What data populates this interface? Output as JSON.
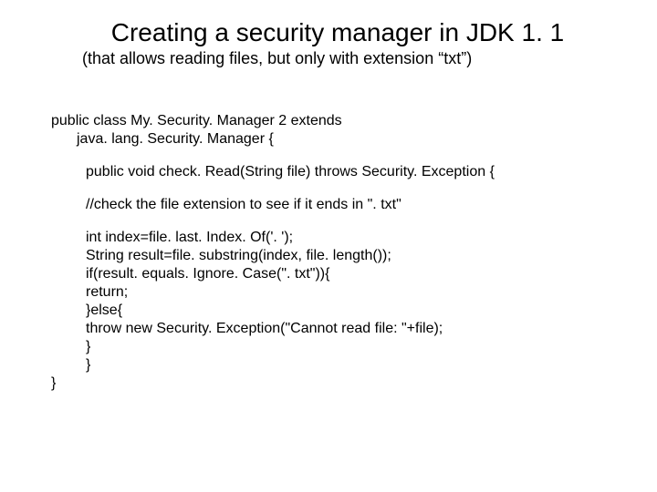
{
  "title": "Creating a security manager in JDK 1. 1",
  "subtitle": "(that allows reading files, but only with extension “txt”)",
  "code": {
    "l1": "public class My. Security. Manager 2 extends",
    "l2": "java. lang. Security. Manager {",
    "l3": "public void check. Read(String file) throws Security. Exception {",
    "l4": "//check the file extension to see if it ends in \". txt\"",
    "l5": "int index=file. last. Index. Of('. ');",
    "l6": "String result=file. substring(index, file. length());",
    "l7": "if(result. equals. Ignore. Case(\". txt\")){",
    "l8": "return;",
    "l9": "}else{",
    "l10": "throw new Security. Exception(\"Cannot read file: \"+file);",
    "l11": "}",
    "l12": "}",
    "l13": "}"
  }
}
